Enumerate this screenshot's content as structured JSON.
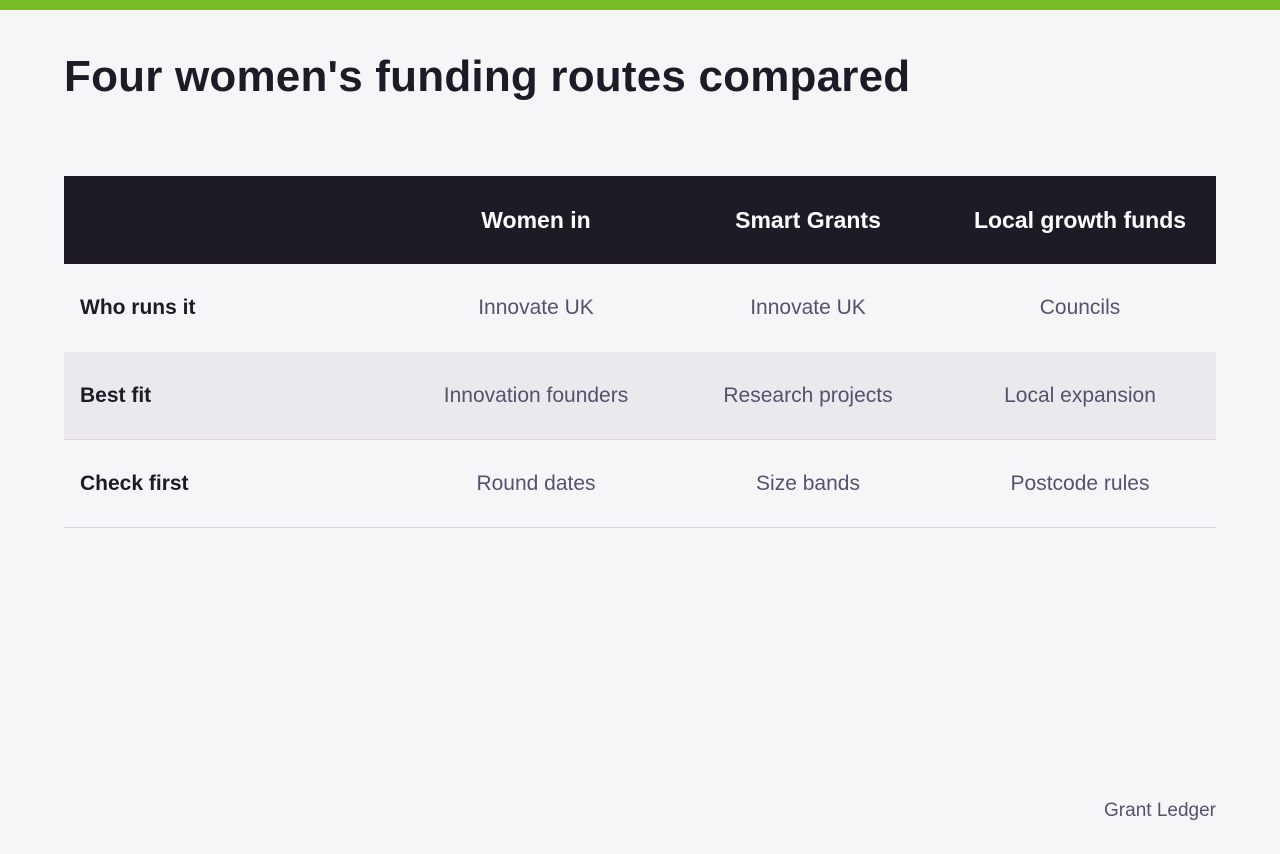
{
  "colors": {
    "accent_bar": "#7bbd27",
    "header_bg": "#1e1a26",
    "page_bg": "#f6f6f9",
    "row_even_bg": "#f6f6f9",
    "row_odd_bg": "#ebe9ee"
  },
  "title": "Four women's funding routes compared",
  "table": {
    "headers": [
      "",
      "Women in",
      "Smart Grants",
      "Local growth funds"
    ],
    "rows": [
      {
        "label": "Who runs it",
        "cells": [
          "Innovate UK",
          "Innovate UK",
          "Councils"
        ]
      },
      {
        "label": "Best fit",
        "cells": [
          "Innovation founders",
          "Research projects",
          "Local expansion"
        ]
      },
      {
        "label": "Check first",
        "cells": [
          "Round dates",
          "Size bands",
          "Postcode rules"
        ]
      }
    ]
  },
  "footer": {
    "brand": "Grant Ledger"
  }
}
